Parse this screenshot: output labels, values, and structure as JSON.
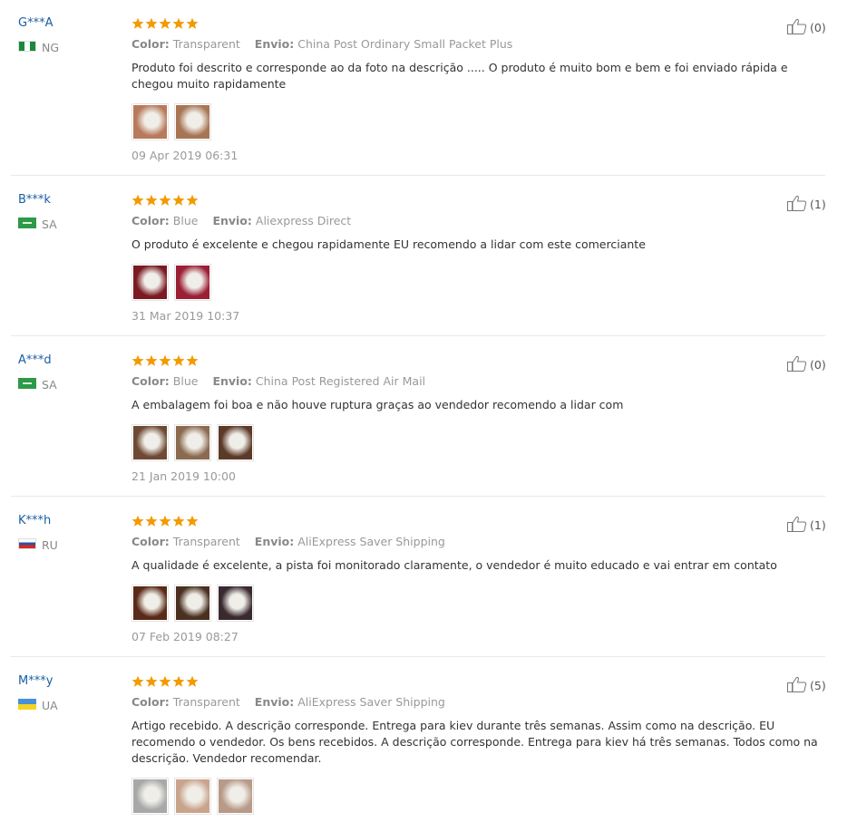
{
  "labels": {
    "color": "Color:",
    "shipping": "Envio:"
  },
  "reviews": [
    {
      "name": "G***A",
      "country": "NG",
      "flag": "ng",
      "color": "Transparent",
      "shipping": "China Post Ordinary Small Packet Plus",
      "text": "Produto foi descrito e corresponde ao da foto na descrição ..... O produto é muito bom e bem e foi enviado rápida e chegou muito rapidamente",
      "date": "09 Apr 2019 06:31",
      "helpful": "(0)",
      "photos": [
        "#b87a5c",
        "#a87554"
      ]
    },
    {
      "name": "B***k",
      "country": "SA",
      "flag": "sa",
      "color": "Blue",
      "shipping": "Aliexpress Direct",
      "text": "O produto é excelente e chegou rapidamente EU recomendo a lidar com este comerciante",
      "date": "31 Mar 2019 10:37",
      "helpful": "(1)",
      "photos": [
        "#7a1a22",
        "#9b1f35"
      ]
    },
    {
      "name": "A***d",
      "country": "SA",
      "flag": "sa",
      "color": "Blue",
      "shipping": "China Post Registered Air Mail",
      "text": "A embalagem foi boa e não houve ruptura graças ao vendedor recomendo a lidar com",
      "date": "21 Jan 2019 10:00",
      "helpful": "(0)",
      "photos": [
        "#6e4a35",
        "#8a6a50",
        "#5c3a28"
      ]
    },
    {
      "name": "K***h",
      "country": "RU",
      "flag": "ru",
      "color": "Transparent",
      "shipping": "AliExpress Saver Shipping",
      "text": "A qualidade é excelente, a pista foi monitorado claramente, o vendedor é muito educado e vai entrar em contato",
      "date": "07 Feb 2019 08:27",
      "helpful": "(1)",
      "photos": [
        "#5a2a18",
        "#4a3020",
        "#3a2a30"
      ]
    },
    {
      "name": "M***y",
      "country": "UA",
      "flag": "ua",
      "color": "Transparent",
      "shipping": "AliExpress Saver Shipping",
      "text": "Artigo recebido. A descrição corresponde. Entrega para kiev durante três semanas. Assim como na descrição. EU recomendo o vendedor. Os bens recebidos. A descrição corresponde. Entrega para kiev há três semanas. Todos como na descrição. Vendedor recomendar.",
      "date": "",
      "helpful": "(5)",
      "photos": [
        "#a8a8a8",
        "#c9a48c",
        "#b89a88"
      ]
    }
  ],
  "colors": {
    "name": "#1a5fa3",
    "star": "#f29a00"
  },
  "icons": {
    "star": "star-icon",
    "thumb": "thumbs-up-icon"
  }
}
